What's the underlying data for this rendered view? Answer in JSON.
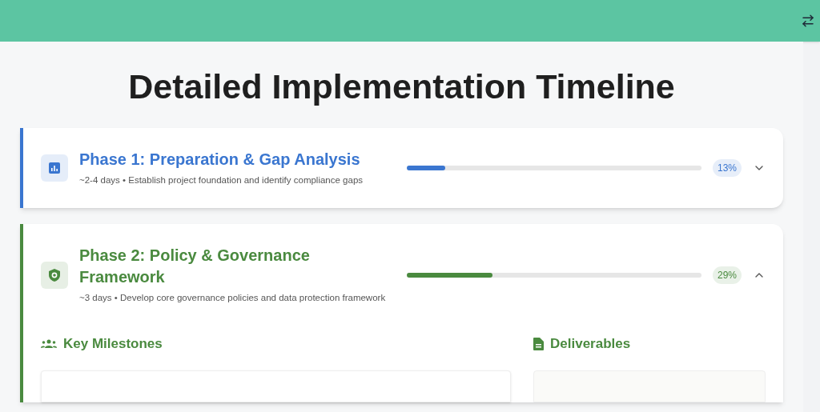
{
  "page_title": "Detailed Implementation Timeline",
  "phases": [
    {
      "kind": "chart",
      "color": "#3a76d0",
      "title": "Phase 1: Preparation & Gap Analysis",
      "subtitle": "~2-4 days • Establish project foundation and identify compliance gaps",
      "level": 0.13,
      "percent": "13%",
      "expanded": false
    },
    {
      "kind": "shield",
      "color": "#4a8a3f",
      "title": "Phase 2: Policy & Governance Framework",
      "subtitle": "~3 days • Develop core governance policies and data protection framework",
      "level": 0.29,
      "percent": "29%",
      "expanded": true,
      "milestones_heading": "Key Milestones",
      "deliverables_heading": "Deliverables"
    }
  ]
}
